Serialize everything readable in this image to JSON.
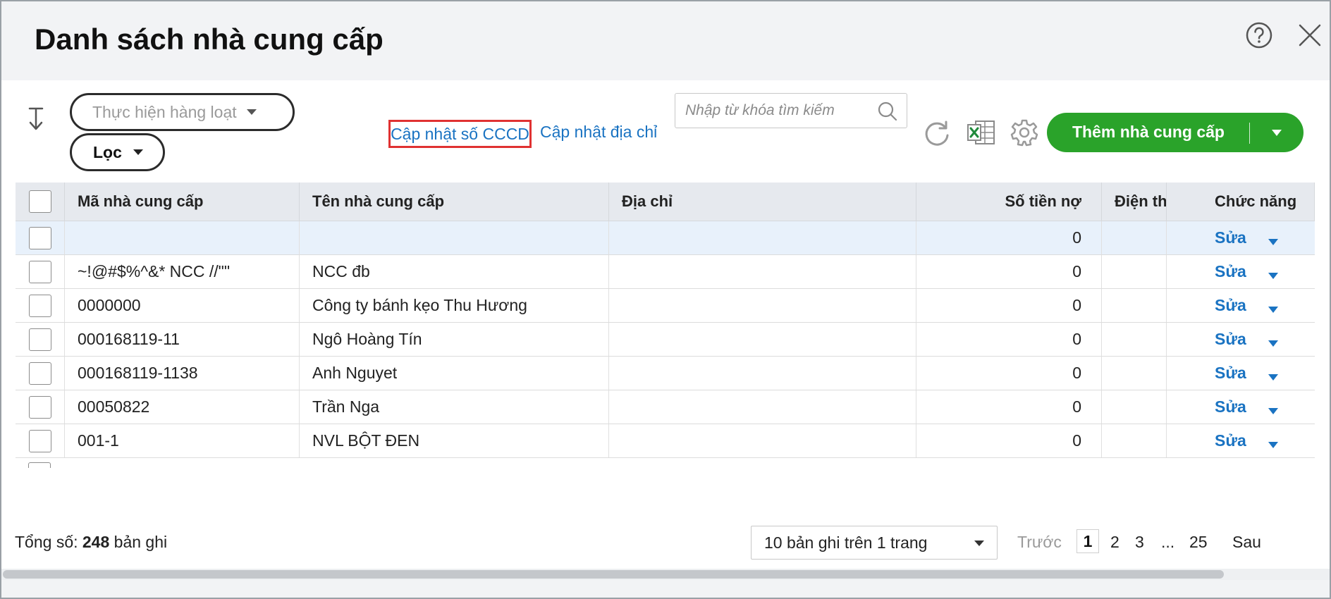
{
  "dialog": {
    "title": "Danh sách nhà cung cấp"
  },
  "toolbar": {
    "bulk_action_label": "Thực hiện hàng loạt",
    "filter_label": "Lọc",
    "update_cccd_link": "Cập nhật số CCCD",
    "update_address_link": "Cập nhật địa chỉ",
    "search_placeholder": "Nhập từ khóa tìm kiếm",
    "add_button_label": "Thêm nhà cung cấp"
  },
  "table": {
    "columns": [
      "Mã nhà cung cấp",
      "Tên nhà cung cấp",
      "Địa chỉ",
      "Số tiền nợ",
      "Điện th",
      "Chức năng"
    ],
    "edit_label": "Sửa",
    "rows": [
      {
        "code": "",
        "name": "",
        "address": "",
        "debt": "0",
        "phone": ""
      },
      {
        "code": "~!@#$%^&* NCC //\"\"",
        "name": "NCC đb",
        "address": "",
        "debt": "0",
        "phone": ""
      },
      {
        "code": "0000000",
        "name": "Công ty bánh kẹo Thu Hương",
        "address": "",
        "debt": "0",
        "phone": ""
      },
      {
        "code": "000168119-11",
        "name": "Ngô Hoàng Tín",
        "address": "",
        "debt": "0",
        "phone": ""
      },
      {
        "code": "000168119-1138",
        "name": "Anh Nguyet",
        "address": "",
        "debt": "0",
        "phone": ""
      },
      {
        "code": "00050822",
        "name": "Trần Nga",
        "address": "",
        "debt": "0",
        "phone": ""
      },
      {
        "code": "001-1",
        "name": "NVL BỘT ĐEN",
        "address": "",
        "debt": "0",
        "phone": ""
      }
    ]
  },
  "footer": {
    "total_prefix": "Tổng số:",
    "total_count": "248",
    "total_suffix": "bản ghi",
    "page_size_label": "10 bản ghi trên 1 trang",
    "prev_label": "Trước",
    "pages": [
      "1",
      "2",
      "3",
      "...",
      "25"
    ],
    "next_label": "Sau"
  },
  "colors": {
    "accent_green": "#2aa32a",
    "link_blue": "#1a73c2",
    "highlight_red": "#e03232"
  }
}
